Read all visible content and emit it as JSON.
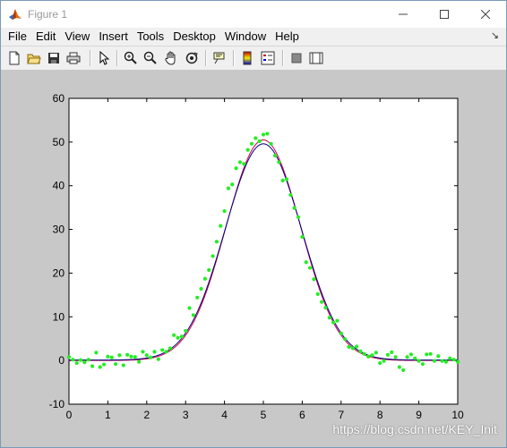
{
  "window": {
    "title": "Figure 1",
    "controls": {
      "minimize": "—",
      "maximize": "☐",
      "close": "✕"
    }
  },
  "menu": [
    "File",
    "Edit",
    "View",
    "Insert",
    "Tools",
    "Desktop",
    "Window",
    "Help"
  ],
  "toolbar_icons": [
    "new-figure-icon",
    "open-file-icon",
    "save-icon",
    "print-icon",
    "edit-plot-icon",
    "zoom-in-icon",
    "zoom-out-icon",
    "pan-icon",
    "rotate-3d-icon",
    "data-cursor-icon",
    "colorbar-icon",
    "legend-icon",
    "hide-plot-tools-icon",
    "show-plot-tools-icon"
  ],
  "watermark": "https://blog.csdn.net/KEY_Init",
  "colors": {
    "canvas_bg": "#c8c8c8",
    "axes_bg": "#ffffff",
    "scatter": "#22ee22",
    "fit_line": "#000080",
    "true_line": "#cc0044"
  },
  "chart_data": {
    "type": "scatter",
    "title": "",
    "xlabel": "",
    "ylabel": "",
    "xlim": [
      0,
      10
    ],
    "ylim": [
      -10,
      60
    ],
    "xticks": [
      0,
      1,
      2,
      3,
      4,
      5,
      6,
      7,
      8,
      9,
      10
    ],
    "yticks": [
      -10,
      0,
      10,
      20,
      30,
      40,
      50,
      60
    ],
    "grid": false,
    "legend": "none",
    "series": [
      {
        "kind": "scatter",
        "color": "#22ee22",
        "x": [
          0.0,
          0.1,
          0.2,
          0.3,
          0.4,
          0.5,
          0.6,
          0.7,
          0.8,
          0.9,
          1.0,
          1.1,
          1.2,
          1.3,
          1.4,
          1.5,
          1.6,
          1.7,
          1.8,
          1.9,
          2.0,
          2.1,
          2.2,
          2.3,
          2.4,
          2.5,
          2.6,
          2.7,
          2.8,
          2.9,
          3.0,
          3.1,
          3.2,
          3.3,
          3.4,
          3.5,
          3.6,
          3.7,
          3.8,
          3.9,
          4.0,
          4.1,
          4.2,
          4.3,
          4.4,
          4.5,
          4.6,
          4.7,
          4.8,
          4.9,
          5.0,
          5.1,
          5.2,
          5.3,
          5.4,
          5.5,
          5.6,
          5.7,
          5.8,
          5.9,
          6.0,
          6.1,
          6.2,
          6.3,
          6.4,
          6.5,
          6.6,
          6.7,
          6.8,
          6.9,
          7.0,
          7.1,
          7.2,
          7.3,
          7.4,
          7.5,
          7.6,
          7.7,
          7.8,
          7.9,
          8.0,
          8.1,
          8.2,
          8.3,
          8.4,
          8.5,
          8.6,
          8.7,
          8.8,
          8.9,
          9.0,
          9.1,
          9.2,
          9.3,
          9.4,
          9.5,
          9.6,
          9.7,
          9.8,
          9.9,
          10.0
        ],
        "y": [
          0.8,
          0.2,
          -0.6,
          0.1,
          -0.4,
          0.2,
          -1.3,
          1.8,
          -1.5,
          -0.9,
          0.9,
          0.7,
          -0.8,
          1.2,
          -1.1,
          1.3,
          0.9,
          0.8,
          -0.3,
          2.0,
          1.2,
          0.7,
          2.0,
          0.3,
          2.4,
          2.0,
          2.8,
          5.8,
          5.2,
          5.5,
          6.8,
          12.0,
          10.4,
          14.4,
          16.4,
          18.7,
          20.7,
          23.9,
          27.2,
          30.8,
          34.2,
          39.4,
          40.3,
          44.0,
          45.4,
          45.0,
          48.2,
          49.6,
          50.9,
          50.2,
          51.7,
          51.9,
          49.6,
          46.9,
          45.4,
          41.2,
          41.5,
          37.9,
          34.9,
          32.8,
          28.3,
          22.5,
          21.2,
          18.6,
          15.2,
          13.4,
          12.1,
          9.8,
          8.7,
          9.1,
          6.2,
          4.9,
          3.1,
          2.8,
          3.2,
          2.1,
          1.5,
          0.9,
          1.2,
          1.8,
          -0.6,
          -0.1,
          1.3,
          1.9,
          0.8,
          -1.5,
          -2.2,
          0.8,
          1.4,
          0.5,
          -0.1,
          -0.8,
          1.4,
          1.5,
          -0.1,
          1.0,
          -0.1,
          -0.3,
          0.5,
          0.2,
          -0.3
        ]
      },
      {
        "kind": "line",
        "color": "#cc0044",
        "model": "gaussian",
        "amplitude": 50.5,
        "center": 5.0,
        "sigma": 0.96,
        "offset": 0.0
      },
      {
        "kind": "line",
        "color": "#000080",
        "model": "gaussian",
        "amplitude": 49.5,
        "center": 5.0,
        "sigma": 0.98,
        "offset": 0.1
      }
    ]
  }
}
